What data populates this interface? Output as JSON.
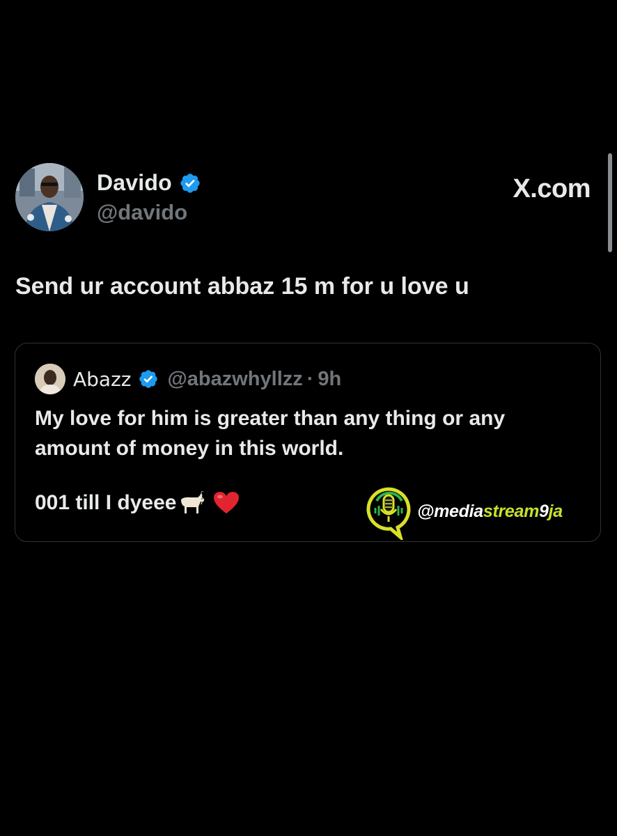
{
  "site": {
    "label": "X.com"
  },
  "author": {
    "name": "Davido",
    "handle": "@davido",
    "avatar_icon": "profile-photo",
    "verified_icon": "verified-badge-icon"
  },
  "tweet": {
    "text": "Send ur account abbaz 15 m for u love u"
  },
  "quoted_tweet": {
    "name": "Abazz",
    "handle": "@abazwhyllzz",
    "separator": "·",
    "time": "9h",
    "body_lines": [
      "My love for him is greater than any thing or any",
      "amount of money in this world."
    ],
    "last_line": "001 till I dyeee",
    "emojis": [
      "goat-icon",
      "red-heart-icon"
    ]
  },
  "watermark": {
    "at": "@",
    "part1": "media",
    "part2": "stream",
    "part3": "9",
    "part4": "ja"
  },
  "colors": {
    "background": "#000000",
    "text_primary": "#e7e9ea",
    "text_secondary": "#71767b",
    "border": "#2f3336",
    "verified": "#1d9bf0",
    "watermark_accent": "#c8e02a"
  }
}
